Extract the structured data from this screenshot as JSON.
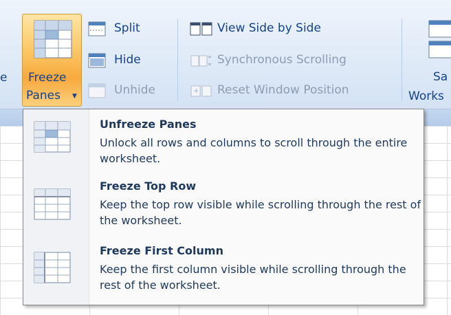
{
  "ribbon": {
    "left_cut_label": "e",
    "freeze_panes": {
      "label_line1": "Freeze",
      "label_line2": "Panes"
    },
    "split": {
      "label": "Split"
    },
    "hide": {
      "label": "Hide"
    },
    "unhide": {
      "label": "Unhide"
    },
    "view_side_by_side": {
      "label": "View Side by Side"
    },
    "synchronous_scrolling": {
      "label": "Synchronous Scrolling"
    },
    "reset_window_position": {
      "label": "Reset Window Position"
    },
    "save_workspace": {
      "label_line1": "Sa",
      "label_line2": "Works"
    }
  },
  "menu": {
    "items": [
      {
        "title": "Unfreeze Panes",
        "description": "Unlock all rows and columns to scroll through the entire worksheet.",
        "icon": "unfreeze-panes-icon"
      },
      {
        "title": "Freeze Top Row",
        "description": "Keep the top row visible while scrolling through the rest of the worksheet.",
        "icon": "freeze-top-row-icon"
      },
      {
        "title": "Freeze First Column",
        "description": "Keep the first column visible while scrolling through the rest of the worksheet.",
        "icon": "freeze-first-column-icon"
      }
    ]
  },
  "colors": {
    "ribbon_text": "#15428b",
    "disabled_text": "#8d9cb3",
    "menu_text": "#1e395b",
    "highlight": "#f8a93e"
  }
}
